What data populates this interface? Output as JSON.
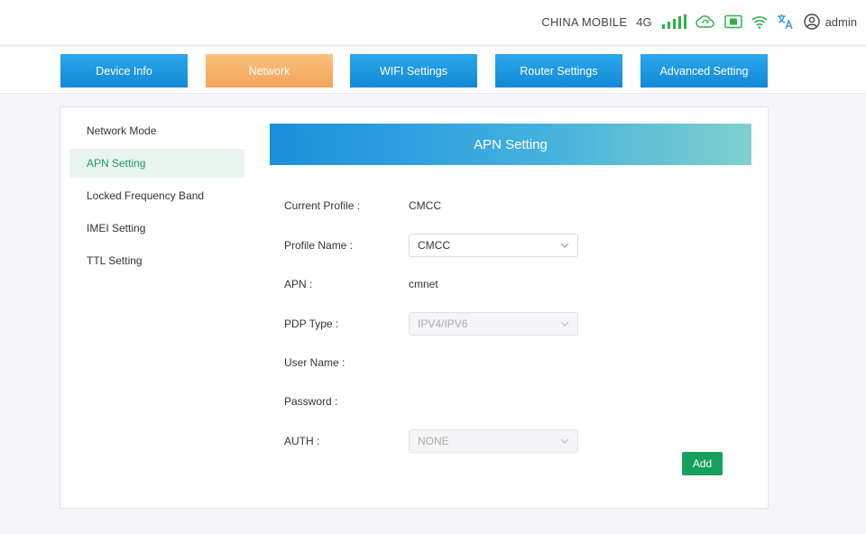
{
  "status": {
    "carrier": "CHINA MOBILE",
    "network_type": "4G",
    "user": "admin",
    "icons": [
      "signal-bars-icon",
      "cloud-sync-icon",
      "sim-card-icon",
      "wifi-icon",
      "translate-icon",
      "user-circle-icon"
    ]
  },
  "nav": {
    "tabs": [
      {
        "label": "Device Info"
      },
      {
        "label": "Network"
      },
      {
        "label": "WIFI Settings"
      },
      {
        "label": "Router Settings"
      },
      {
        "label": "Advanced Setting"
      }
    ],
    "active_tab": "Network"
  },
  "sidebar": {
    "items": [
      {
        "label": "Network Mode"
      },
      {
        "label": "APN Setting"
      },
      {
        "label": "Locked Frequency Band"
      },
      {
        "label": "IMEI Setting"
      },
      {
        "label": "TTL Setting"
      }
    ],
    "active_item": "APN Setting"
  },
  "form": {
    "title": "APN Setting",
    "current_profile": {
      "label": "Current Profile :",
      "value": "CMCC"
    },
    "profile_name": {
      "label": "Profile Name :",
      "value": "CMCC"
    },
    "apn": {
      "label": "APN :",
      "value": "cmnet"
    },
    "pdp_type": {
      "label": "PDP Type :",
      "value": "IPV4/IPV6"
    },
    "user_name": {
      "label": "User Name :",
      "value": ""
    },
    "password": {
      "label": "Password :",
      "value": ""
    },
    "auth": {
      "label": "AUTH :",
      "value": "NONE"
    },
    "add_label": "Add"
  },
  "colors": {
    "nav_blue": "#1a90da",
    "nav_active_orange": "#f6ad64",
    "active_green_text": "#1f9a6a",
    "add_button_green": "#16a05b",
    "status_icon_green": "#2db04b"
  }
}
